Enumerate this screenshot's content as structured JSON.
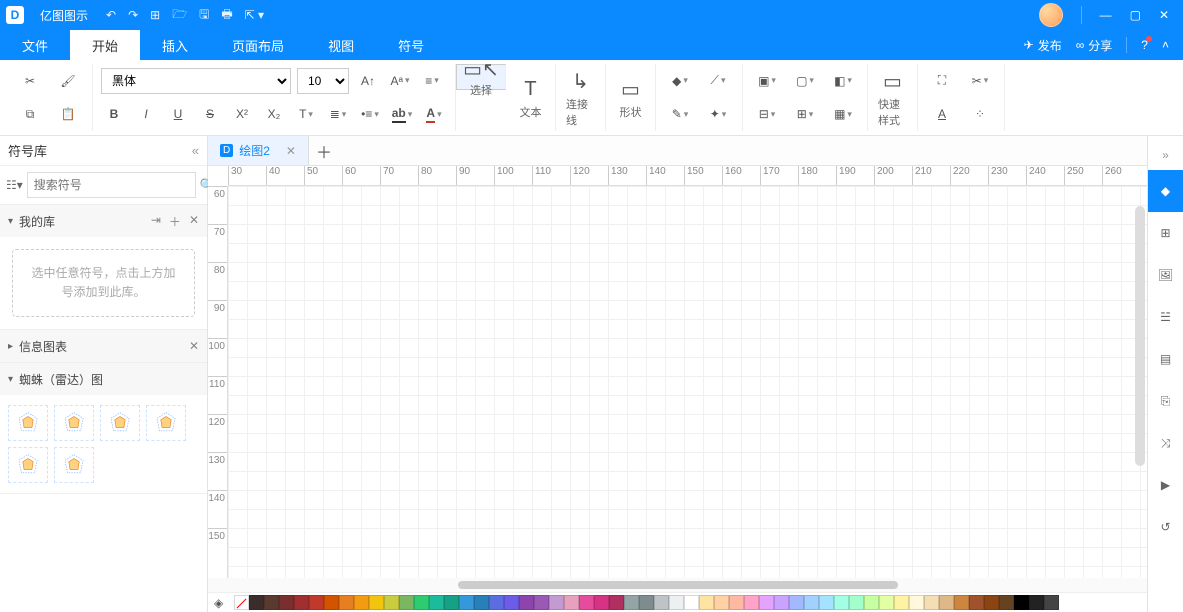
{
  "app": {
    "name": "亿图图示"
  },
  "quick_access": [
    "undo",
    "redo",
    "new",
    "open",
    "save",
    "print",
    "share"
  ],
  "window_controls": [
    "minimize",
    "maximize",
    "close"
  ],
  "menu": {
    "tabs": [
      "文件",
      "开始",
      "插入",
      "页面布局",
      "视图",
      "符号"
    ],
    "active": "开始",
    "publish": "发布",
    "share": "分享"
  },
  "ribbon": {
    "font_name": "黑体",
    "font_size": "10",
    "tools": {
      "select": "选择",
      "text": "文本",
      "connector": "连接线",
      "shape": "形状",
      "quick_style": "快速样式"
    }
  },
  "sidebar": {
    "title": "符号库",
    "search_placeholder": "搜索符号",
    "sections": {
      "mylib": {
        "title": "我的库",
        "empty_text": "选中任意符号，点击上方加号添加到此库。"
      },
      "info": {
        "title": "信息图表"
      },
      "radar": {
        "title": "蜘蛛（雷达）图",
        "shape_count": 6
      }
    }
  },
  "doc_tab": {
    "name": "绘图2"
  },
  "ruler": {
    "h": [
      "30",
      "40",
      "50",
      "60",
      "70",
      "80",
      "90",
      "100",
      "110",
      "120",
      "130",
      "140",
      "150",
      "160",
      "170",
      "180",
      "190",
      "200",
      "210",
      "220",
      "230",
      "240",
      "250",
      "260"
    ],
    "v": [
      "60",
      "70",
      "80",
      "90",
      "100",
      "110",
      "120",
      "130",
      "140",
      "150"
    ]
  },
  "color_swatches": [
    "#3b2e2a",
    "#5a3a2f",
    "#7a2f2f",
    "#a03030",
    "#c0392b",
    "#d35400",
    "#e67e22",
    "#f39c12",
    "#f1c40f",
    "#c9cc3f",
    "#7bb661",
    "#2ecc71",
    "#1abc9c",
    "#16a085",
    "#3498db",
    "#2980b9",
    "#5b6ee1",
    "#6c5ce7",
    "#8e44ad",
    "#9b59b6",
    "#c39bd3",
    "#e8a0bf",
    "#e74c9c",
    "#d63384",
    "#b03060",
    "#95a5a6",
    "#7f8c8d",
    "#bdc3c7",
    "#ecf0f1",
    "#ffffff",
    "#ffe3a3",
    "#ffd1a3",
    "#ffb9a3",
    "#ffa3c9",
    "#e3a3ff",
    "#c9a3ff",
    "#a3b9ff",
    "#a3d1ff",
    "#a3e3ff",
    "#a3ffe3",
    "#a3ffc9",
    "#c9ffa3",
    "#e3ffa3",
    "#fff3a3",
    "#fff8dc",
    "#f5deb3",
    "#deb887",
    "#cd853f",
    "#a0522d",
    "#8b4513",
    "#654321",
    "#000000",
    "#222222",
    "#444444"
  ],
  "right_tools": [
    "style",
    "grid",
    "image",
    "layers",
    "page",
    "attach",
    "shuffle",
    "present",
    "history"
  ]
}
